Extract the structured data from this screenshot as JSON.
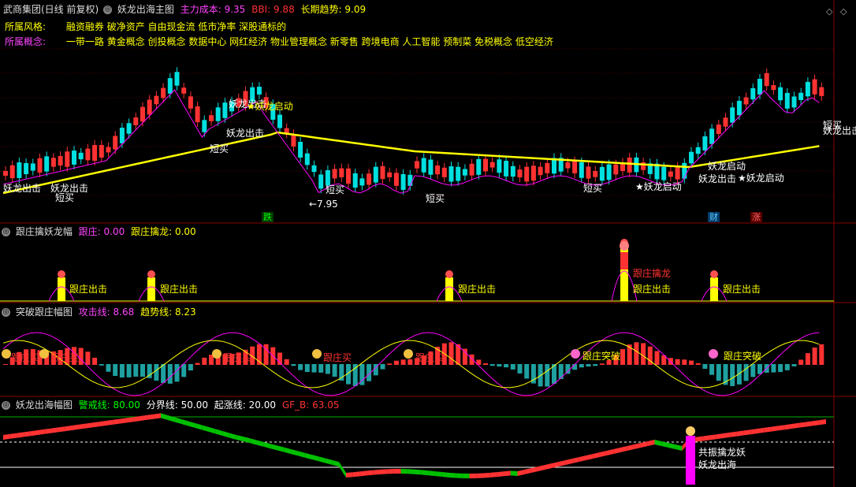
{
  "main": {
    "stock": "武商集团(日线 前复权)",
    "indicator": "妖龙出海主图",
    "cost_label": "主力成本:",
    "cost_value": "9.35",
    "bbi_label": "BBI:",
    "bbi_value": "9.88",
    "trend_label": "长期趋势:",
    "trend_value": "9.09",
    "style_label": "所属风格:",
    "style_value": "融资融券 破净资产 自由现金流 低市净率 深股通标的",
    "concept_label": "所属概念:",
    "concept_value": "一带一路 黄金概念 创投概念 数据中心 网红经济 物业管理概念 新零售 跨境电商 人工智能 预制菜 免税概念 低空经济",
    "low_price": "←7.95",
    "tags": {
      "die": "跌",
      "cai": "财",
      "zhang": "涨"
    },
    "annotations": {
      "duanmai": "短买",
      "yaolong_chuji": "妖龙出击",
      "yaolong_qidong": "妖龙启动",
      "yaolong_qidong_star": "★妖龙启动"
    }
  },
  "pane2": {
    "title": "跟庄擒妖龙幅",
    "f1_label": "跟庄:",
    "f1_value": "0.00",
    "f2_label": "跟庄擒龙:",
    "f2_value": "0.00",
    "label_chuji": "跟庄出击",
    "label_qinlong": "跟庄擒龙"
  },
  "pane3": {
    "title": "突破跟庄幅图",
    "f1_label": "攻击线:",
    "f1_value": "8.68",
    "f2_label": "趋势线:",
    "f2_value": "8.23",
    "label_mai": "跟庄买",
    "label_tupo": "跟庄突破"
  },
  "pane4": {
    "title": "妖龙出海幅图",
    "f1_label": "警戒线:",
    "f1_value": "80.00",
    "f2_label": "分界线:",
    "f2_value": "50.00",
    "f3_label": "起涨线:",
    "f3_value": "20.00",
    "f4_label": "GF_B:",
    "f4_value": "63.05",
    "label_gongzhen": "共振擒龙妖",
    "label_chuhai": "妖龙出海"
  },
  "colors": {
    "up": "#ff3232",
    "down": "#00e0e0",
    "yellow": "#ffff00",
    "purple": "#8a2be2",
    "magenta": "#ff00ff",
    "white": "#ffffff",
    "green": "#00c000",
    "border": "#8a0000"
  },
  "icons": [
    "toggle-icon",
    "diamond-icon",
    "money-bag-icon",
    "gear-icon"
  ]
}
